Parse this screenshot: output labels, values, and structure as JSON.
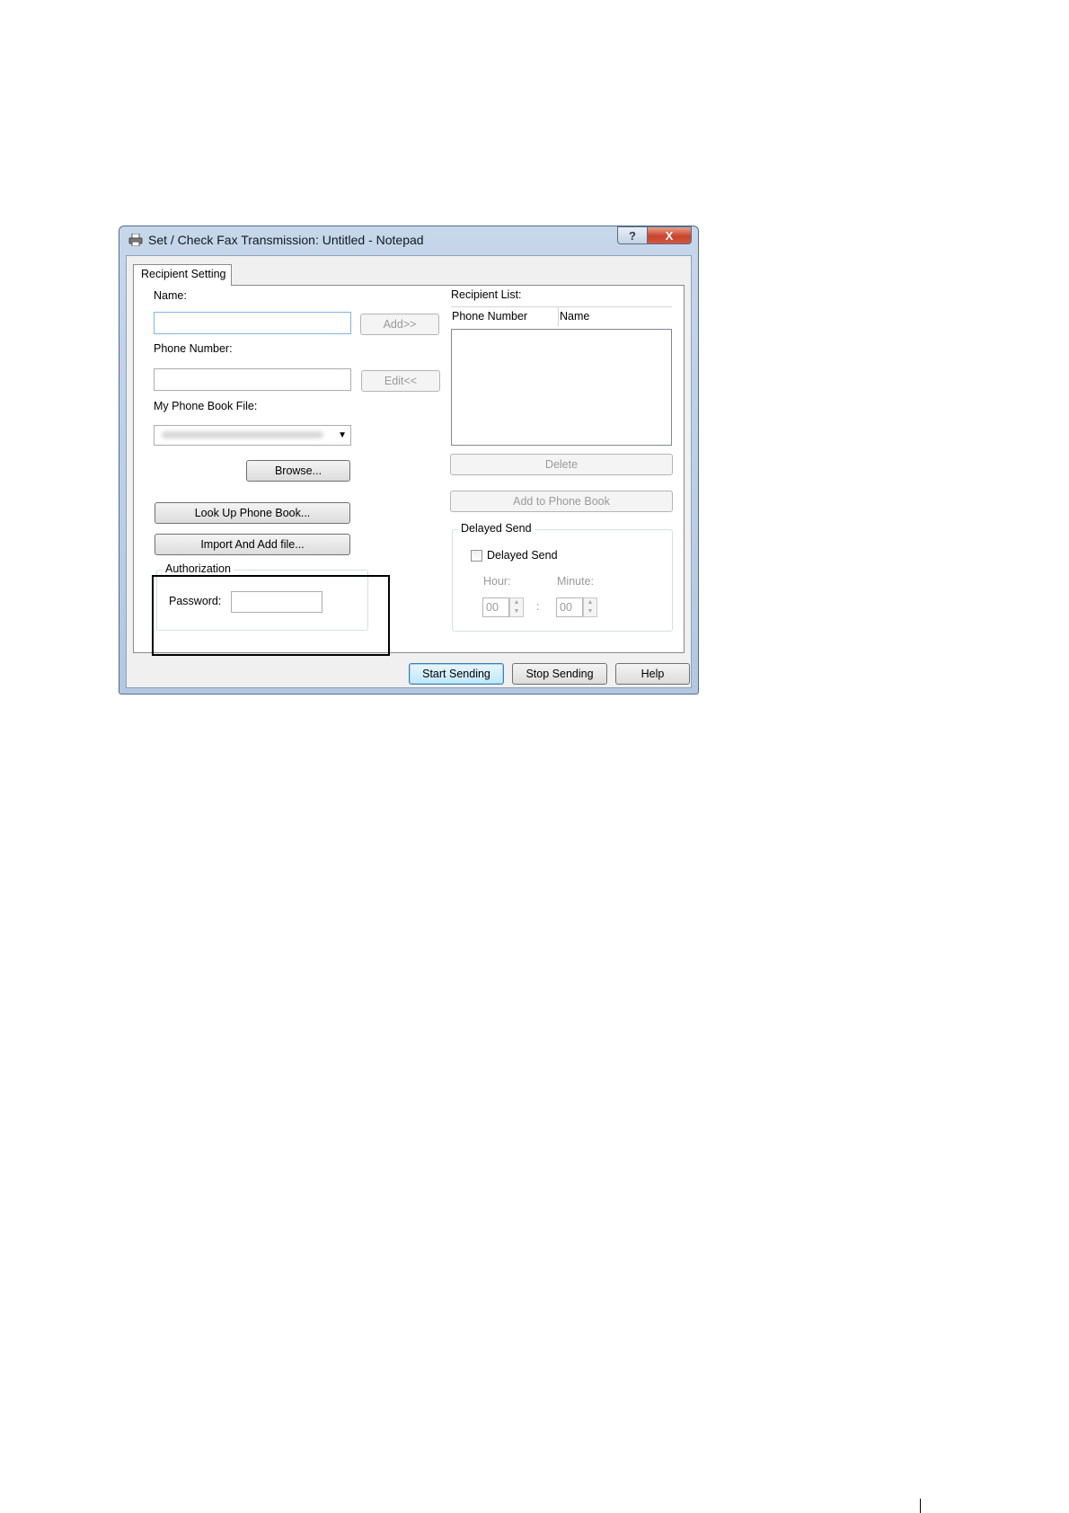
{
  "window": {
    "title": "Set / Check Fax Transmission:  Untitled - Notepad",
    "help_button": "?",
    "close_button": "X"
  },
  "tabs": [
    {
      "label": "Recipient Setting"
    }
  ],
  "left": {
    "name_label": "Name:",
    "name_value": "",
    "add_button": "Add>>",
    "phone_label": "Phone Number:",
    "phone_value": "",
    "edit_button": "Edit<<",
    "phonebook_label": "My Phone Book File:",
    "browse_button": "Browse...",
    "lookup_button": "Look Up Phone Book...",
    "import_button": "Import And Add file..."
  },
  "authorization": {
    "title": "Authorization",
    "password_label": "Password:",
    "password_value": ""
  },
  "recipient_list": {
    "label": "Recipient List:",
    "columns": [
      "Phone Number",
      "Name"
    ],
    "rows": []
  },
  "right": {
    "delete_button": "Delete",
    "add_to_phonebook_button": "Add to Phone Book"
  },
  "delayed_send": {
    "group_title": "Delayed Send",
    "checkbox_label": "Delayed Send",
    "checked": false,
    "hour_label": "Hour:",
    "minute_label": "Minute:",
    "hour_value": "00",
    "minute_value": "00",
    "separator": ":"
  },
  "footer": {
    "start_button": "Start Sending",
    "stop_button": "Stop Sending",
    "help_button": "Help"
  },
  "colors": {
    "frame": "#b3c8e0",
    "close_button": "#c8442c",
    "default_button": "#bee6fd"
  }
}
